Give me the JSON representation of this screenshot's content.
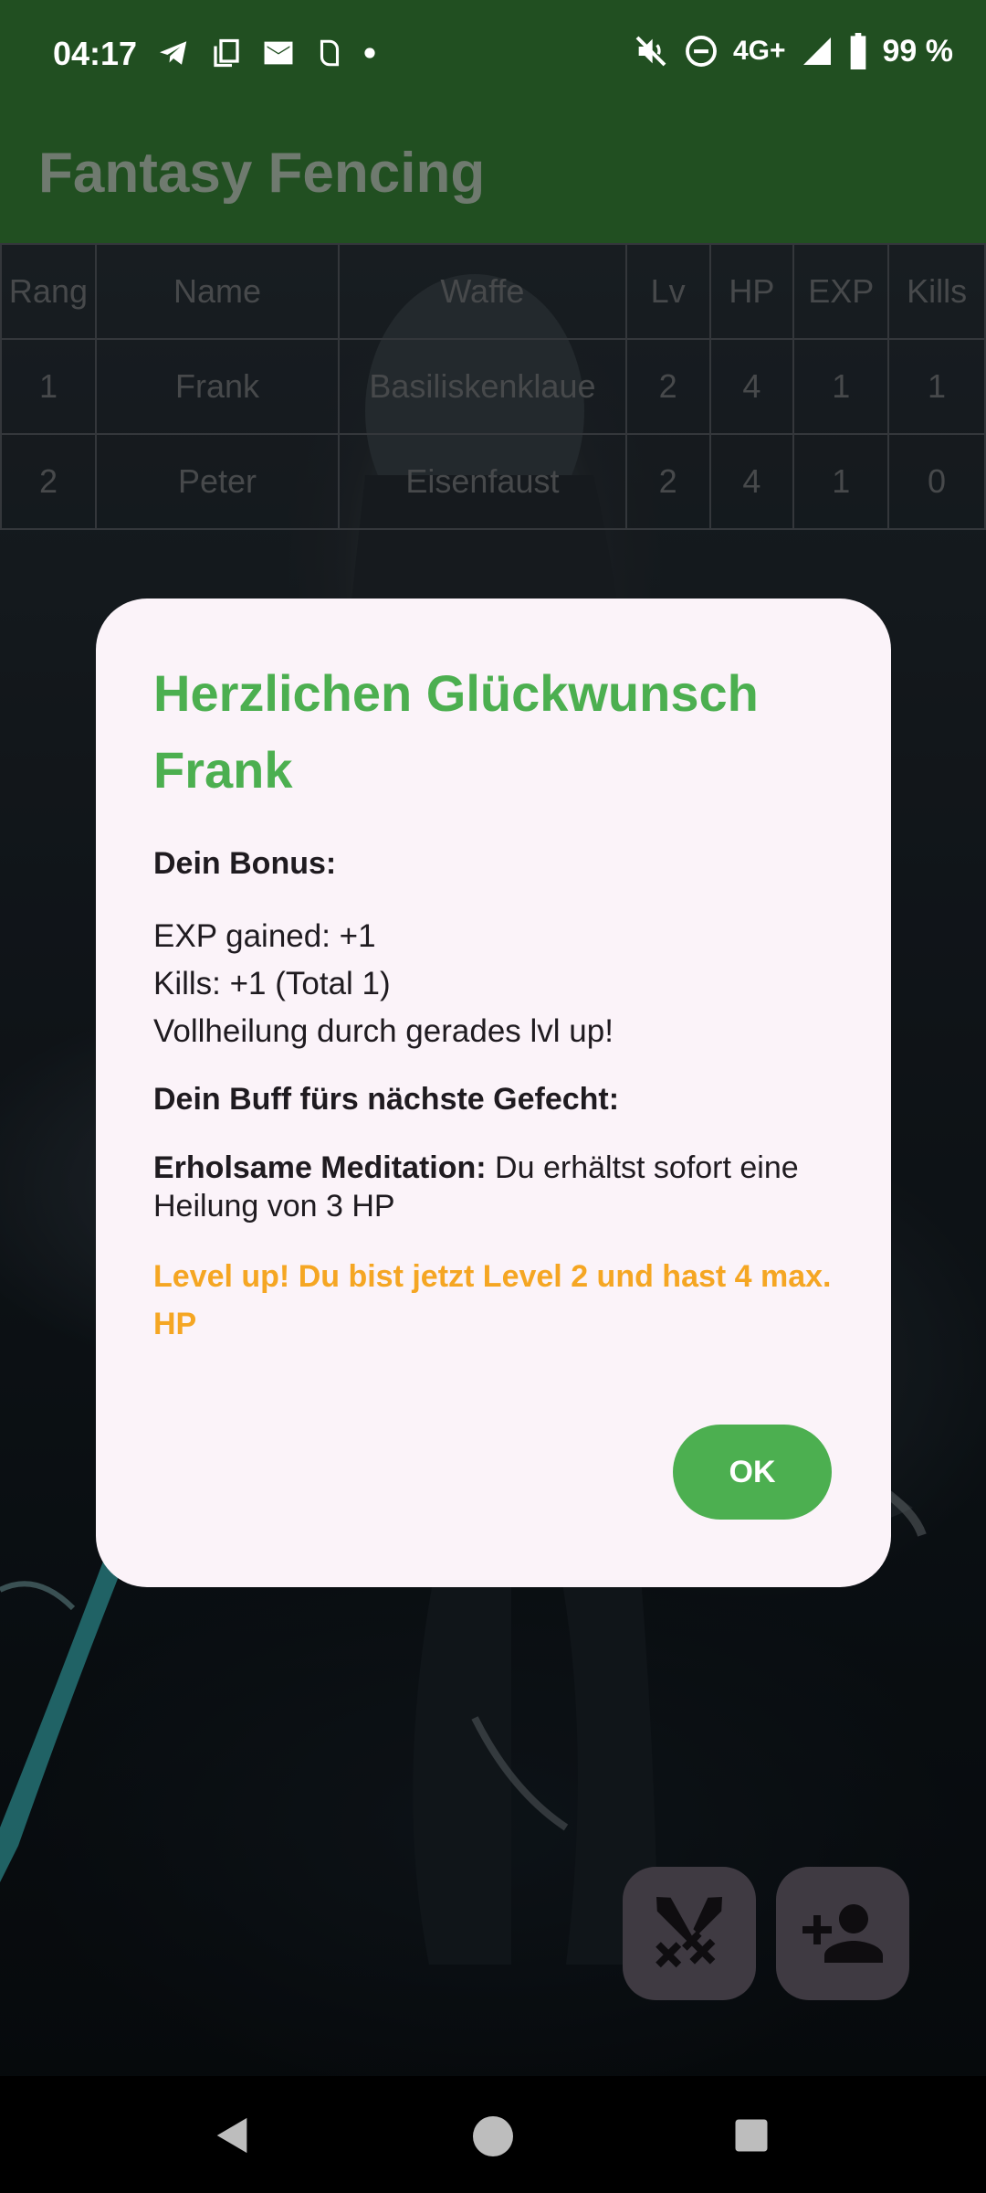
{
  "status_bar": {
    "time": "04:17",
    "network": "4G+",
    "battery": "99 %",
    "left_icons": [
      "telegram-icon",
      "copy-icon",
      "mail-icon",
      "app-icon",
      "dot-icon"
    ],
    "right_icons": [
      "mute-icon",
      "dnd-icon",
      "signal-icon",
      "battery-icon"
    ]
  },
  "app": {
    "title": "Fantasy Fencing"
  },
  "leaderboard": {
    "columns": [
      "Rang",
      "Name",
      "Waffe",
      "Lv",
      "HP",
      "EXP",
      "Kills"
    ],
    "rows": [
      [
        "1",
        "Frank",
        "Basiliskenklaue",
        "2",
        "4",
        "1",
        "1"
      ],
      [
        "2",
        "Peter",
        "Eisenfaust",
        "2",
        "4",
        "1",
        "0"
      ]
    ]
  },
  "dialog": {
    "title": "Herzlichen Glückwunsch Frank",
    "bonus_heading": "Dein Bonus:",
    "bonus_lines": [
      "EXP gained: +1",
      "Kills: +1 (Total 1)",
      "Vollheilung durch gerades lvl up!"
    ],
    "buff_heading": "Dein Buff fürs nächste Gefecht:",
    "buff_name": "Erholsame Meditation:",
    "buff_text": " Du erhältst sofort eine Heilung von 3 HP",
    "level_up": "Level up! Du bist jetzt Level 2 und hast 4 max. HP",
    "ok_label": "OK",
    "title_color": "#4caf50",
    "level_up_color": "#f5a623"
  },
  "fabs": {
    "battle_icon": "crossed-swords-icon",
    "add_icon": "person-add-icon"
  },
  "nav": {
    "icons": [
      "back-icon",
      "home-icon",
      "recents-icon"
    ]
  }
}
